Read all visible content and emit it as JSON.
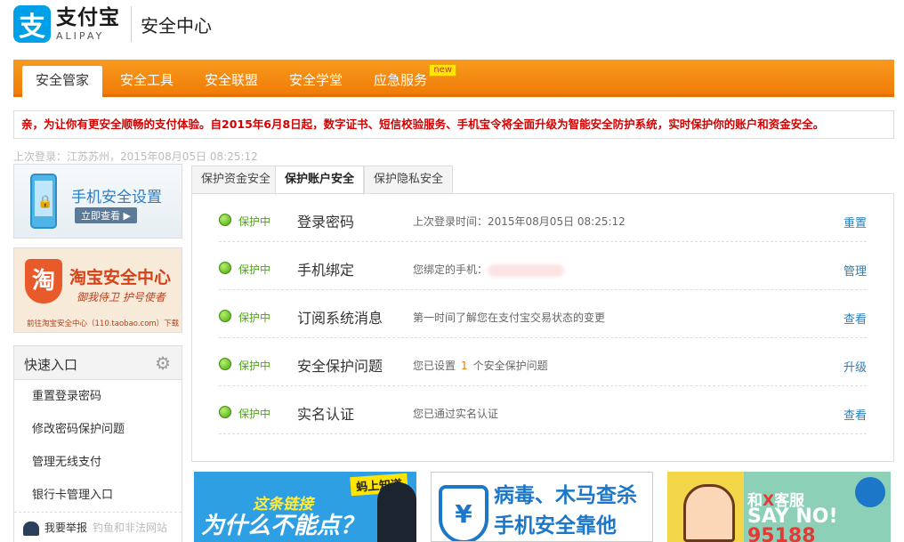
{
  "header": {
    "logo_mark": "支",
    "logo_cn": "支付宝",
    "logo_en": "ALIPAY",
    "title": "安全中心"
  },
  "nav": {
    "items": [
      "安全管家",
      "安全工具",
      "安全联盟",
      "安全学堂",
      "应急服务"
    ],
    "active_index": 0,
    "new_badge": "new",
    "color": "#f07c08"
  },
  "notice": "亲，为让你有更安全顺畅的支付体验。自2015年6月8日起，数字证书、短信校验服务、手机宝令将全面升级为智能安全防护系统，实时保护你的账户和资金安全。",
  "last_login": "上次登录：江苏苏州，2015年08月05日 08:25:12",
  "left_banners": {
    "phone_security": {
      "title": "手机安全设置",
      "button": "立即查看 ▶"
    },
    "taobao_security": {
      "icon": "淘",
      "title": "淘宝安全中心",
      "slogan": "御我侍卫 护号使者",
      "footer": "前往淘宝安全中心（110.taobao.com）下载"
    }
  },
  "quick": {
    "title": "快速入口",
    "items": [
      "重置登录密码",
      "修改密码保护问题",
      "管理无线支付",
      "银行卡管理入口"
    ],
    "report": "我要举报",
    "report_note": "钓鱼和非法网站"
  },
  "tabs": [
    "保护资金安全",
    "保护账户安全",
    "保护隐私安全"
  ],
  "active_tab": 1,
  "rows": [
    {
      "status": "保护中",
      "name": "登录密码",
      "desc": "上次登录时间：2015年08月05日 08:25:12",
      "action": "重置"
    },
    {
      "status": "保护中",
      "name": "手机绑定",
      "desc": "您绑定的手机：",
      "action": "管理"
    },
    {
      "status": "保护中",
      "name": "订阅系统消息",
      "desc": "第一时间了解您在支付宝交易状态的变更",
      "action": "查看"
    },
    {
      "status": "保护中",
      "name": "安全保护问题",
      "desc_before": "您已设置",
      "desc_num": "1",
      "desc_after": "个安全保护问题",
      "action": "升级"
    },
    {
      "status": "保护中",
      "name": "实名认证",
      "desc": "您已通过实名认证",
      "action": "查看"
    }
  ],
  "ads": {
    "ad1": {
      "tag": "蚂上知道",
      "line1": "这条链接",
      "line2": "为什么不能点？"
    },
    "ad2": {
      "icon": "¥",
      "line1": "病毒、木马查杀",
      "line2": "手机安全靠他"
    },
    "ad3": {
      "line1_a": "和",
      "line1_x": "X",
      "line1_b": "客服",
      "line2": "SAY NO!",
      "line3": "95188"
    }
  }
}
